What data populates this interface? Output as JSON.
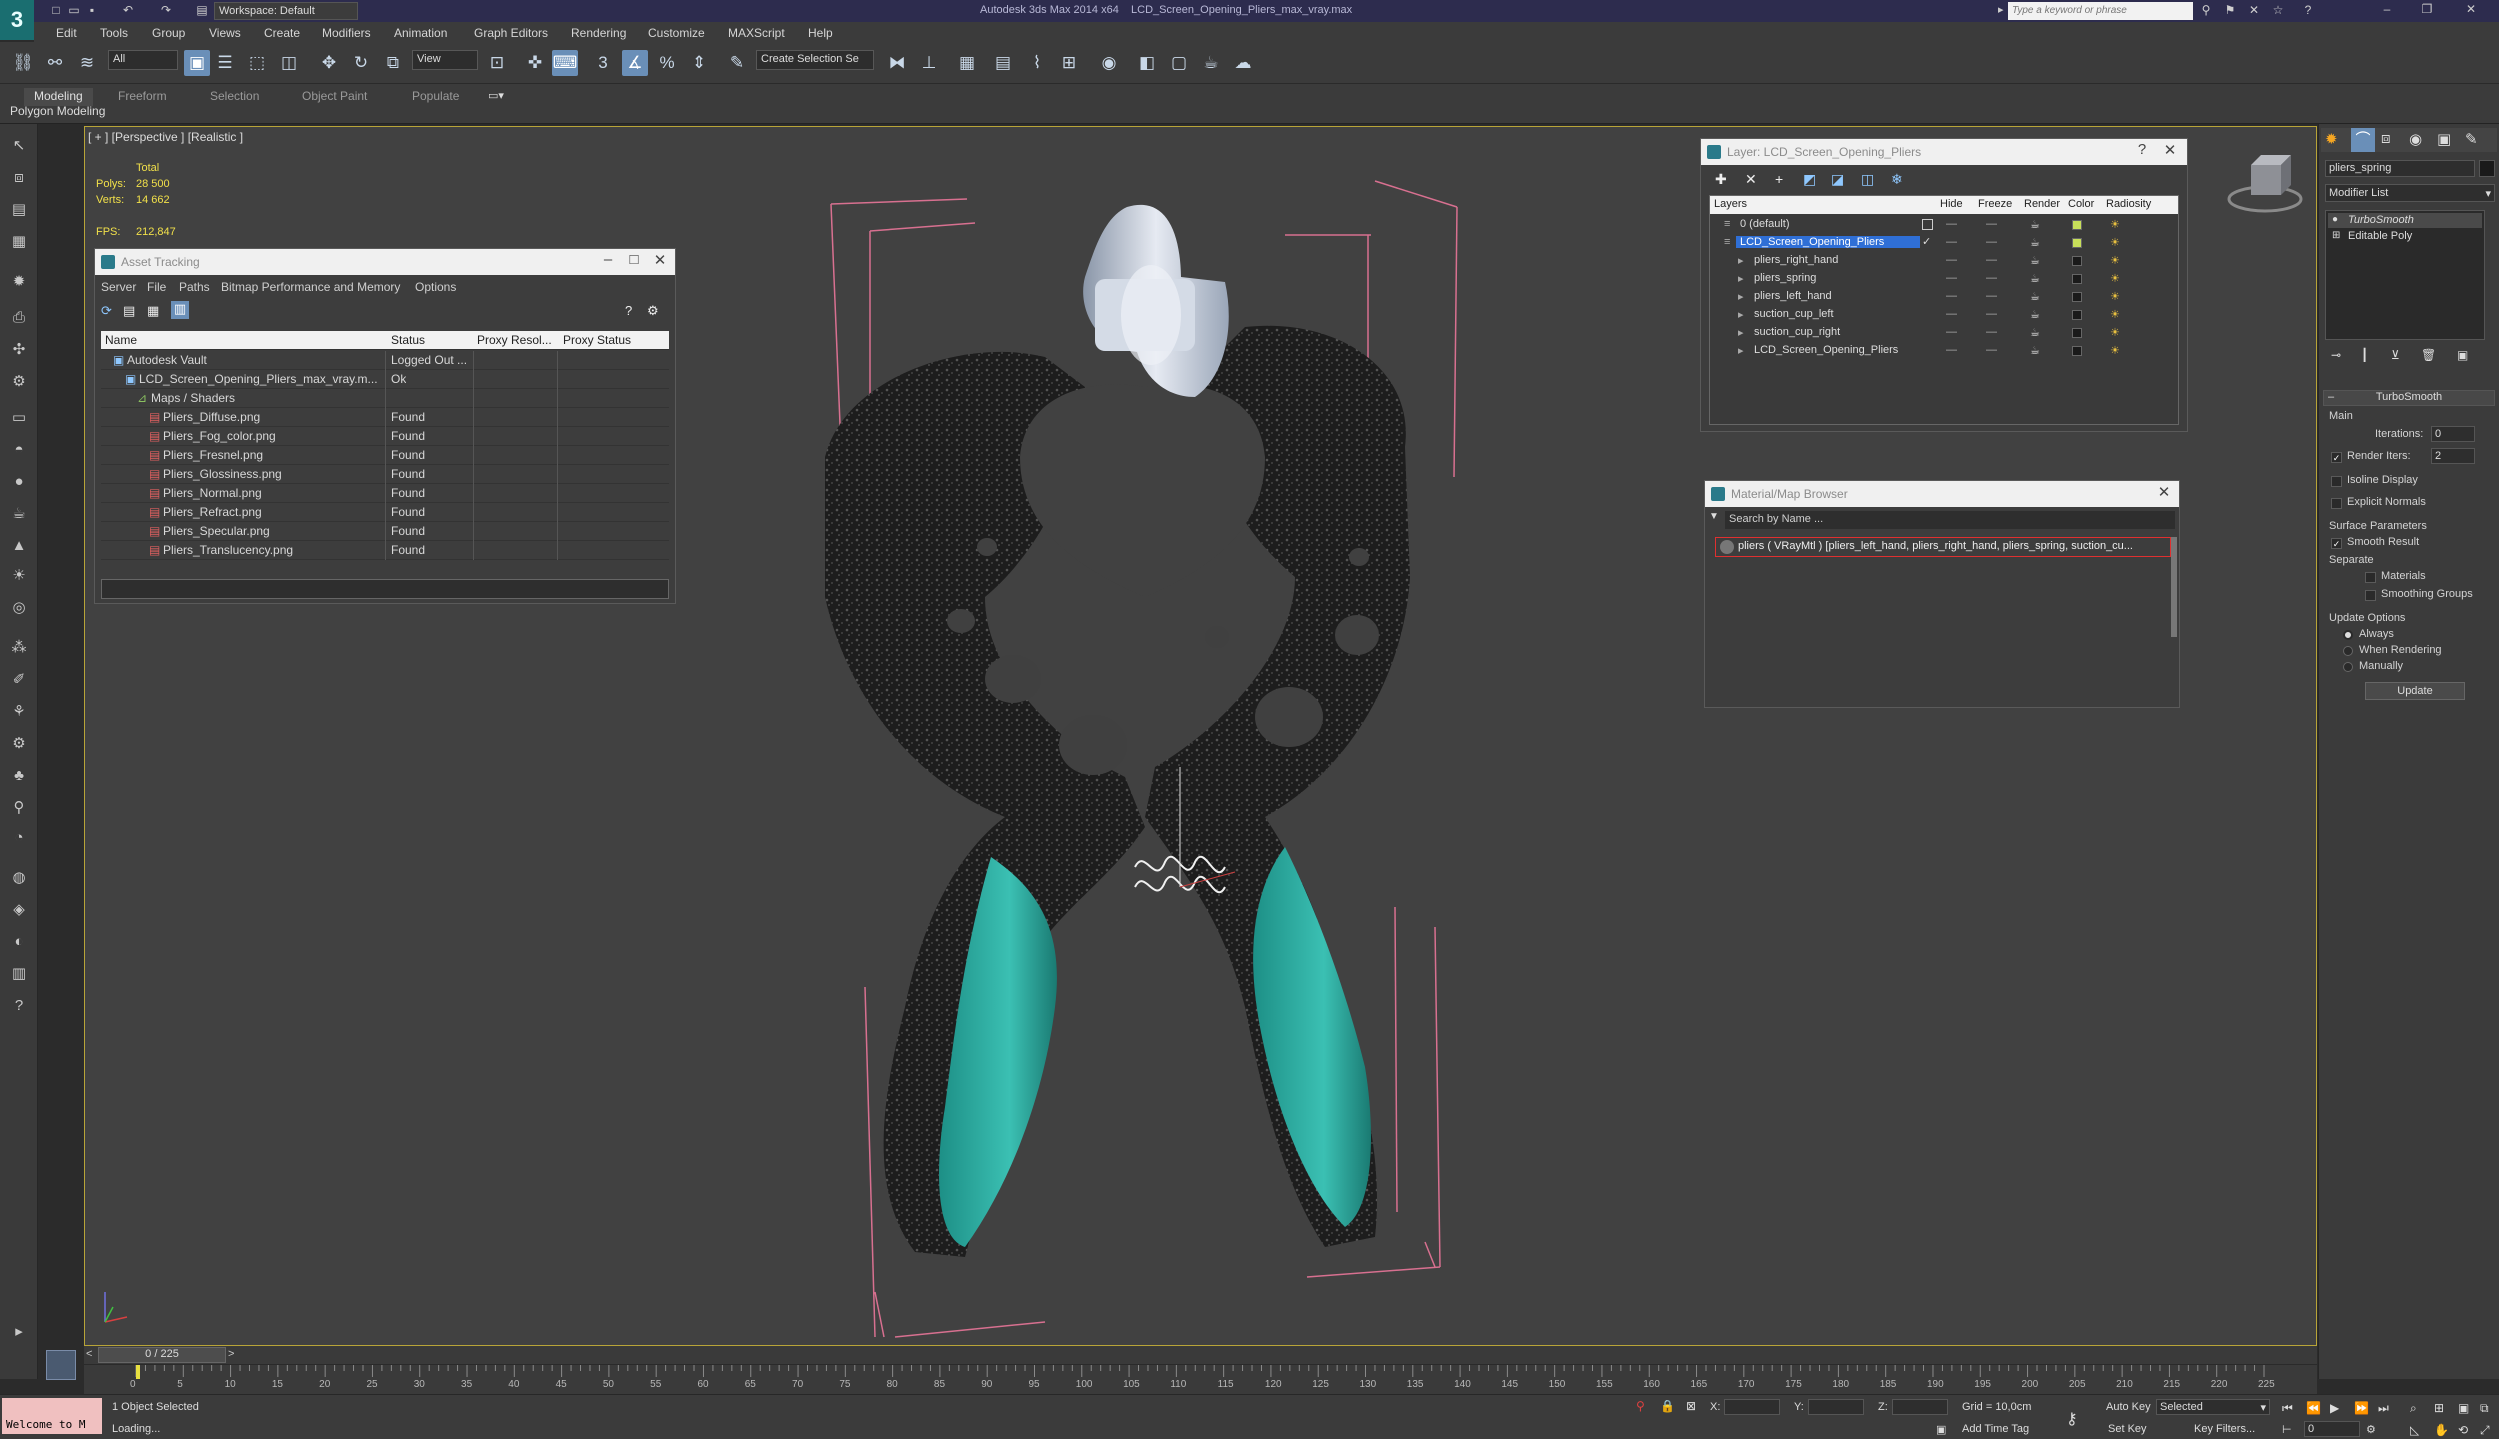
{
  "title": {
    "app_name": "Autodesk 3ds Max  2014 x64",
    "file_name": "LCD_Screen_Opening_Pliers_max_vray.max",
    "workspace": "Workspace: Default",
    "search_placeholder": "Type a keyword or phrase"
  },
  "menu": [
    "Edit",
    "Tools",
    "Group",
    "Views",
    "Create",
    "Modifiers",
    "Animation",
    "Graph Editors",
    "Rendering",
    "Customize",
    "MAXScript",
    "Help"
  ],
  "toolbar": {
    "selection_filter": "All",
    "ref_coord": "View",
    "named_selection": "Create Selection Se",
    "snap_label": "3",
    "percent_label": "%"
  },
  "ribbon": {
    "tabs": [
      "Modeling",
      "Freeform",
      "Selection",
      "Object Paint",
      "Populate"
    ],
    "active_tab": "Modeling",
    "panel_label": "Polygon Modeling"
  },
  "viewport": {
    "label": "[ + ] [Perspective ] [Realistic ]",
    "stats": {
      "total_label": "Total",
      "polys_label": "Polys:",
      "polys_value": "28 500",
      "verts_label": "Verts:",
      "verts_value": "14 662",
      "fps_label": "FPS:",
      "fps_value": "212,847"
    }
  },
  "asset_tracking": {
    "title": "Asset Tracking",
    "menu": [
      "Server",
      "File",
      "Paths",
      "Bitmap Performance and Memory",
      "Options"
    ],
    "columns": [
      "Name",
      "Status",
      "Proxy Resol...",
      "Proxy Status"
    ],
    "rows": [
      {
        "name": "Autodesk Vault",
        "status": "Logged Out ...",
        "indent": 1
      },
      {
        "name": "LCD_Screen_Opening_Pliers_max_vray.m...",
        "status": "Ok",
        "indent": 2
      },
      {
        "name": "Maps / Shaders",
        "status": "",
        "indent": 3
      },
      {
        "name": "Pliers_Diffuse.png",
        "status": "Found",
        "indent": 4
      },
      {
        "name": "Pliers_Fog_color.png",
        "status": "Found",
        "indent": 4
      },
      {
        "name": "Pliers_Fresnel.png",
        "status": "Found",
        "indent": 4
      },
      {
        "name": "Pliers_Glossiness.png",
        "status": "Found",
        "indent": 4
      },
      {
        "name": "Pliers_Normal.png",
        "status": "Found",
        "indent": 4
      },
      {
        "name": "Pliers_Refract.png",
        "status": "Found",
        "indent": 4
      },
      {
        "name": "Pliers_Specular.png",
        "status": "Found",
        "indent": 4
      },
      {
        "name": "Pliers_Translucency.png",
        "status": "Found",
        "indent": 4
      }
    ]
  },
  "layer_manager": {
    "title": "Layer: LCD_Screen_Opening_Pliers",
    "columns": [
      "Layers",
      "Hide",
      "Freeze",
      "Render",
      "Color",
      "Radiosity"
    ],
    "rows": [
      {
        "name": "0 (default)",
        "indent": 1,
        "selected": false,
        "color": "#c8e05a"
      },
      {
        "name": "LCD_Screen_Opening_Pliers",
        "indent": 1,
        "selected": true,
        "color": "#c8e05a"
      },
      {
        "name": "pliers_right_hand",
        "indent": 2,
        "selected": false,
        "color": "#1a1a1a"
      },
      {
        "name": "pliers_spring",
        "indent": 2,
        "selected": false,
        "color": "#1a1a1a"
      },
      {
        "name": "pliers_left_hand",
        "indent": 2,
        "selected": false,
        "color": "#1a1a1a"
      },
      {
        "name": "suction_cup_left",
        "indent": 2,
        "selected": false,
        "color": "#1a1a1a"
      },
      {
        "name": "suction_cup_right",
        "indent": 2,
        "selected": false,
        "color": "#1a1a1a"
      },
      {
        "name": "LCD_Screen_Opening_Pliers",
        "indent": 2,
        "selected": false,
        "color": "#1a1a1a"
      }
    ]
  },
  "material_browser": {
    "title": "Material/Map Browser",
    "search_placeholder": "Search by Name ...",
    "item": "pliers  ( VRayMtl ) [pliers_left_hand, pliers_right_hand, pliers_spring, suction_cu..."
  },
  "command_panel": {
    "object_name": "pliers_spring",
    "modifier_list": "Modifier List",
    "stack": [
      "TurboSmooth",
      "Editable Poly"
    ],
    "rollout_title": "TurboSmooth",
    "main_label": "Main",
    "iterations_label": "Iterations:",
    "iterations_value": "0",
    "render_iters_label": "Render Iters:",
    "render_iters_value": "2",
    "isoline_label": "Isoline Display",
    "explicit_normals_label": "Explicit Normals",
    "surface_params_label": "Surface Parameters",
    "smooth_result_label": "Smooth Result",
    "separate_label": "Separate",
    "materials_label": "Materials",
    "smoothing_groups_label": "Smoothing Groups",
    "update_options_label": "Update Options",
    "always_label": "Always",
    "when_rendering_label": "When Rendering",
    "manually_label": "Manually",
    "update_button": "Update"
  },
  "timeline": {
    "frame_readout": "0 / 225",
    "ticks": [
      "0",
      "5",
      "10",
      "15",
      "20",
      "25",
      "30",
      "35",
      "40",
      "45",
      "50",
      "55",
      "60",
      "65",
      "70",
      "75",
      "80",
      "85",
      "90",
      "95",
      "100",
      "105",
      "110",
      "115",
      "120",
      "125",
      "130",
      "135",
      "140",
      "145",
      "150",
      "155",
      "160",
      "165",
      "170",
      "175",
      "180",
      "185",
      "190",
      "195",
      "200",
      "205",
      "210",
      "215",
      "220",
      "225"
    ]
  },
  "status": {
    "maxscript": "Welcome to M",
    "selection_status": "1 Object Selected",
    "prompt": "Loading...",
    "x_label": "X:",
    "y_label": "Y:",
    "z_label": "Z:",
    "grid": "Grid = 10,0cm",
    "add_time_tag": "Add Time Tag",
    "auto_key": "Auto Key",
    "set_key": "Set Key",
    "selected_dropdown": "Selected",
    "key_filters": "Key Filters...",
    "frame_value": "0"
  }
}
